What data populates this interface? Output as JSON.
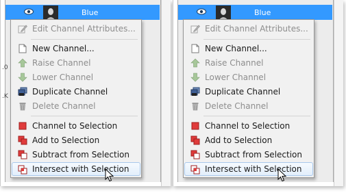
{
  "layer": {
    "name": "Blue"
  },
  "menu": {
    "items": [
      {
        "label": "Edit Channel Attributes...",
        "enabled": false,
        "icon": "edit-icon"
      },
      {
        "label": "New Channel...",
        "enabled": true,
        "icon": "new-page-icon"
      },
      {
        "label": "Raise Channel",
        "enabled": false,
        "icon": "arrow-up-icon"
      },
      {
        "label": "Lower Channel",
        "enabled": false,
        "icon": "arrow-down-icon"
      },
      {
        "label": "Duplicate Channel",
        "enabled": true,
        "icon": "duplicate-icon"
      },
      {
        "label": "Delete Channel",
        "enabled": false,
        "icon": "trash-icon"
      },
      {
        "label": "Channel to Selection",
        "enabled": true,
        "icon": "channel-to-selection-icon"
      },
      {
        "label": "Add to Selection",
        "enabled": true,
        "icon": "add-selection-icon"
      },
      {
        "label": "Subtract from Selection",
        "enabled": true,
        "icon": "subtract-selection-icon"
      },
      {
        "label": "Intersect with Selection",
        "enabled": true,
        "icon": "intersect-selection-icon",
        "hovered": true
      }
    ]
  },
  "edge_labels": [
    ".0",
    ".K"
  ],
  "colors": {
    "selection_blue": "#3399ff",
    "menu_background": "#f1f1f1",
    "disabled_text": "#8d8d8d",
    "selection_red": "#e03b3b"
  }
}
